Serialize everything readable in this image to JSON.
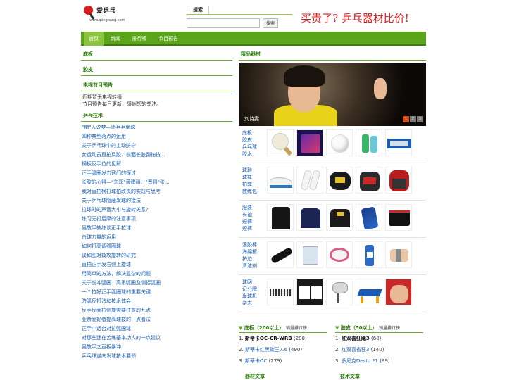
{
  "header": {
    "logo_title": "爱乒乓",
    "logo_url": "www.ipingpang.com",
    "search_tab": "搜索",
    "search_placeholder": "",
    "search_button": "搜索",
    "slogan": "买贵了? 乒乓器材比价!"
  },
  "nav": {
    "items": [
      {
        "label": "首页",
        "active": true
      },
      {
        "label": "新闻",
        "active": false
      },
      {
        "label": "排行榜",
        "active": false
      },
      {
        "label": "节目预告",
        "active": false
      }
    ]
  },
  "left": {
    "sec_dibian": "底板",
    "sec_jiaopi": "胶皮",
    "sec_tv": "电视节目预告",
    "tv_line1": "近期暂无电视转播",
    "tv_line2": "节目预告每日更新，感谢您的关注。",
    "sec_tech": "乒乓技术",
    "tech_items": [
      "\"痴\"人说梦—迷乒乒倒球",
      "四种典型落点的运用",
      "关于乒乓球中的主动防守",
      "女运动员直拍反胶、前面长胶倒拍技...",
      "横板反手位的见解",
      "正手弧圈发力窍门的探讨",
      "长胶的心得—\"东邪\"黄建疆，\"晋阳\"张...",
      "我对直拍横打球拍改良的实践与思考",
      "关于乒乓球隐蔽发球的接法",
      "拉球时的声音大小与旋转关系?",
      "练习无打后摩的注意事项",
      "吴敬平教练谈正手拉球",
      "击球力量的运用",
      "如何打高调弧圈球",
      "谈如图对拨攻旋转的研究",
      "直拍正手发右侧上旋球",
      "用简单的方法，解决复杂的问题",
      "关于前冲弧圈、高吊弧圈及侧拐弧圈",
      "一个拉好正手弧圈球的重要关键",
      "防弧反打法和技术体会",
      "反手反面拉侧旋需要注意的九点",
      "业余爱好者提高球技的一点看法",
      "正手中远台对拉弧圈球",
      "对那些迷在苦练基本功人的一点建议",
      "吴敬平之直板暴冲",
      "乒乓球逆向发球技术要领"
    ]
  },
  "right": {
    "sec_title": "精品器材",
    "banner_caption": "刘诗雯",
    "banner_pages": [
      "1",
      "2",
      "3"
    ],
    "product_rows": [
      {
        "cats": [
          "底板",
          "胶皮",
          "乒乓球",
          "胶水"
        ]
      },
      {
        "cats": [
          "球鞋",
          "球袜",
          "拍套",
          "教练包"
        ]
      },
      {
        "cats": [
          "服装",
          "长袖",
          "短裤",
          "短裤"
        ]
      },
      {
        "cats": [
          "滚胶棒",
          "海绵擦",
          "护边",
          "清洁剂"
        ]
      },
      {
        "cats": [
          "球网",
          "记分牌",
          "发球机",
          "杂志"
        ]
      }
    ],
    "rank_dibian": {
      "title": "底板（200以上）",
      "sub": "销量排行榜",
      "items": [
        {
          "rank": "1.",
          "name": "斯蒂卡OC-CR-WRB",
          "count": "(280)",
          "bold": true
        },
        {
          "rank": "2.",
          "name": "斯蒂卡红黑碳王7.6",
          "count": "(490)",
          "bold": false
        },
        {
          "rank": "3.",
          "name": "斯蒂卡OC",
          "count": "(279)",
          "bold": false
        }
      ]
    },
    "rank_jiaopi": {
      "title": "胶皮（50以上）",
      "sub": "销量排行榜",
      "items": [
        {
          "rank": "1.",
          "name": "红双喜狂飚3",
          "count": "(68)",
          "bold": true
        },
        {
          "rank": "2.",
          "name": "红双喜省狂3",
          "count": "(140)",
          "bold": false
        },
        {
          "rank": "3.",
          "name": "多尼克Desto F1",
          "count": "(99)",
          "bold": false
        }
      ]
    },
    "bottom_left": "器材文章",
    "bottom_right": "技术文章"
  }
}
